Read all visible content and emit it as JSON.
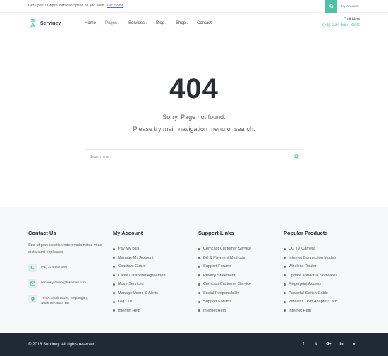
{
  "topbar": {
    "promo_text": "Get Up to 1 Gbps Download Speed on $98.50/m",
    "promo_link": "Get It Now",
    "account_label": "My Account"
  },
  "header": {
    "brand": "Serviney",
    "nav": [
      {
        "label": "Home",
        "dropdown": false,
        "active": false
      },
      {
        "label": "Pages",
        "dropdown": true,
        "active": true
      },
      {
        "label": "Services",
        "dropdown": true,
        "active": false
      },
      {
        "label": "Blog",
        "dropdown": true,
        "active": false
      },
      {
        "label": "Shop",
        "dropdown": true,
        "active": false
      },
      {
        "label": "Contact",
        "dropdown": false,
        "active": false
      }
    ],
    "call_label": "Call Now",
    "call_number": "(+1) 234-567-8900"
  },
  "main": {
    "code": "404",
    "message1": "Sorry. Page not found.",
    "message2": "Please try main navigation menu or search.",
    "search_placeholder": "Search here..."
  },
  "footer": {
    "contact": {
      "title": "Contact Us",
      "about": "Sed ut perspiciatis unde omnis natus vitae dicta sunt explicabo.",
      "phone": "(+1) 234-567-890",
      "email": "serviney.demo@fakemail.com",
      "address": "784/A Zirtoli Bazar, Begumganj, Noakhali-3800, BD"
    },
    "account": {
      "title": "My Account",
      "items": [
        "Pay My Bills",
        "Manage My Account",
        "Constant Guard",
        "Cable Customer Agreement",
        "Move Services",
        "Manage Users & Alerts",
        "Log Out",
        "Internet Help"
      ]
    },
    "support": {
      "title": "Support Links",
      "items": [
        "Comcast Customer Service",
        "Bill & Payment Methods",
        "Support Forums",
        "Privacy Statement",
        "Comcast Customer Service",
        "Social Responsibility",
        "Support Forums",
        "Internet Help"
      ]
    },
    "products": {
      "title": "Popular Products",
      "items": [
        "CC TV Camera",
        "Internet Connection Modem",
        "Wireless Router",
        "Update Anti-virus Softwares",
        "Fingerprint Access",
        "Powerful Switch Cable",
        "Wireless USB Adapter/Card",
        "Internet Help"
      ]
    }
  },
  "bottombar": {
    "copyright": "© 2018 Serviney. All rights reserved.",
    "socials": [
      {
        "glyph": "f",
        "icon": "facebook-icon"
      },
      {
        "glyph": "t",
        "icon": "twitter-icon"
      },
      {
        "glyph": "G+",
        "icon": "google-plus-icon"
      },
      {
        "glyph": "in",
        "icon": "linkedin-icon"
      },
      {
        "glyph": "v",
        "icon": "vimeo-icon"
      }
    ]
  },
  "colors": {
    "accent_green": "#4cc3a6",
    "link_blue": "#5b6ec8",
    "dark_footer": "#1e2a35"
  }
}
